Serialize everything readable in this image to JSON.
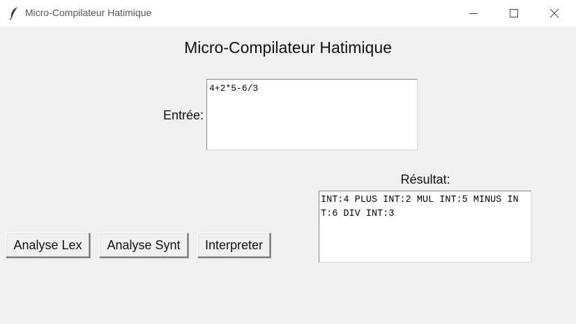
{
  "window": {
    "title": "Micro-Compilateur Hatimique",
    "icon": "feather-icon",
    "controls": [
      "minimize-icon",
      "maximize-icon",
      "close-icon"
    ]
  },
  "main": {
    "heading": "Micro-Compilateur Hatimique",
    "input_label": "Entrée:",
    "input_value": "4+2*5-6/3",
    "result_label": "Résultat:",
    "result_text": "INT:4 PLUS INT:2 MUL INT:5 MINUS INT:6 DIV INT:3"
  },
  "buttons": {
    "lex": "Analyse Lex",
    "synt": "Analyse Synt",
    "interp": "Interpreter"
  }
}
